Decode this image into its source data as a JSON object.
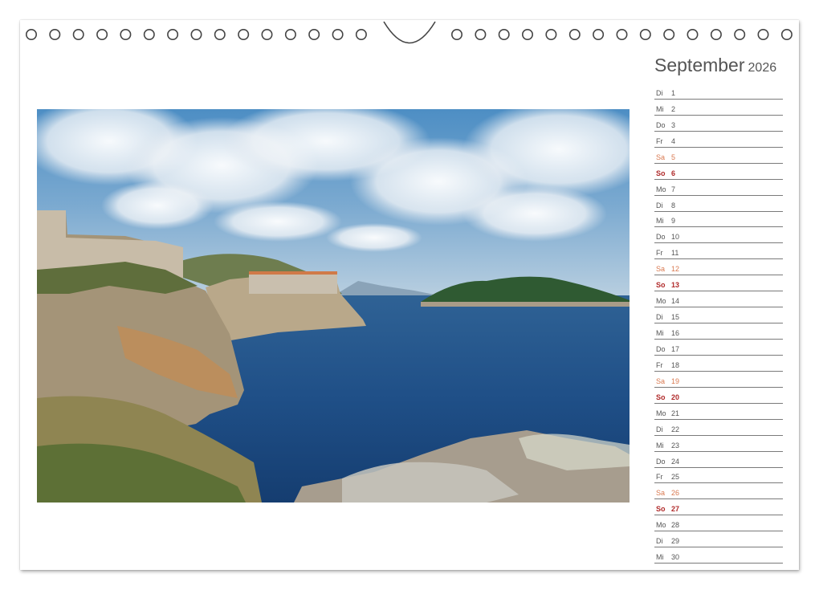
{
  "calendar": {
    "month": "September",
    "year": "2026",
    "days": [
      {
        "wd": "Di",
        "d": "1",
        "t": "weekday"
      },
      {
        "wd": "Mi",
        "d": "2",
        "t": "weekday"
      },
      {
        "wd": "Do",
        "d": "3",
        "t": "weekday"
      },
      {
        "wd": "Fr",
        "d": "4",
        "t": "weekday"
      },
      {
        "wd": "Sa",
        "d": "5",
        "t": "sat"
      },
      {
        "wd": "So",
        "d": "6",
        "t": "sun"
      },
      {
        "wd": "Mo",
        "d": "7",
        "t": "weekday"
      },
      {
        "wd": "Di",
        "d": "8",
        "t": "weekday"
      },
      {
        "wd": "Mi",
        "d": "9",
        "t": "weekday"
      },
      {
        "wd": "Do",
        "d": "10",
        "t": "weekday"
      },
      {
        "wd": "Fr",
        "d": "11",
        "t": "weekday"
      },
      {
        "wd": "Sa",
        "d": "12",
        "t": "sat"
      },
      {
        "wd": "So",
        "d": "13",
        "t": "sun"
      },
      {
        "wd": "Mo",
        "d": "14",
        "t": "weekday"
      },
      {
        "wd": "Di",
        "d": "15",
        "t": "weekday"
      },
      {
        "wd": "Mi",
        "d": "16",
        "t": "weekday"
      },
      {
        "wd": "Do",
        "d": "17",
        "t": "weekday"
      },
      {
        "wd": "Fr",
        "d": "18",
        "t": "weekday"
      },
      {
        "wd": "Sa",
        "d": "19",
        "t": "sat"
      },
      {
        "wd": "So",
        "d": "20",
        "t": "sun"
      },
      {
        "wd": "Mo",
        "d": "21",
        "t": "weekday"
      },
      {
        "wd": "Di",
        "d": "22",
        "t": "weekday"
      },
      {
        "wd": "Mi",
        "d": "23",
        "t": "weekday"
      },
      {
        "wd": "Do",
        "d": "24",
        "t": "weekday"
      },
      {
        "wd": "Fr",
        "d": "25",
        "t": "weekday"
      },
      {
        "wd": "Sa",
        "d": "26",
        "t": "sat"
      },
      {
        "wd": "So",
        "d": "27",
        "t": "sun"
      },
      {
        "wd": "Mo",
        "d": "28",
        "t": "weekday"
      },
      {
        "wd": "Di",
        "d": "29",
        "t": "weekday"
      },
      {
        "wd": "Mi",
        "d": "30",
        "t": "weekday"
      }
    ]
  },
  "colors": {
    "saturday": "#d97950",
    "sunday": "#b02a2a",
    "text": "#555555",
    "rule": "#7a7a7a"
  },
  "photo": {
    "subject": "coastal-fortress-photo"
  }
}
